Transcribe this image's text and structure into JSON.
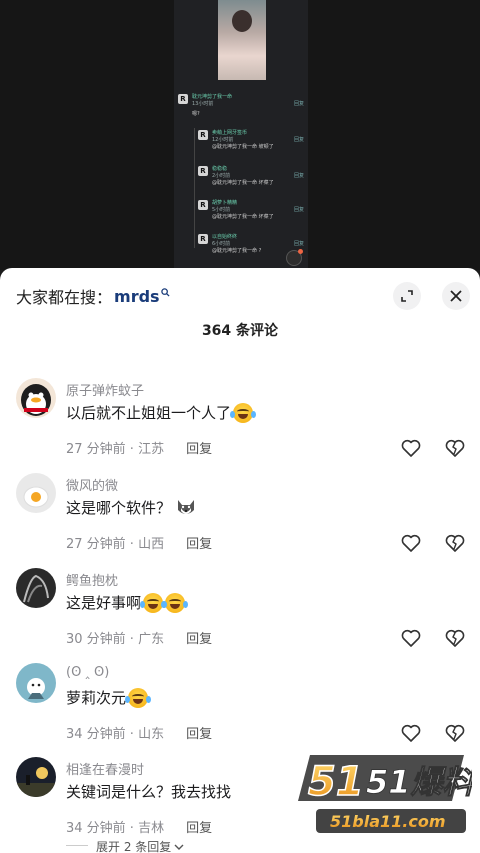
{
  "embedded_thread": {
    "top_comment_user": "耽元坤剪了我一命",
    "top_comment_time": "13小时前",
    "top_comment_text": "嗯?",
    "replies": [
      {
        "user": "卖萌上网牙签币",
        "time": "12小时前",
        "text": "@耽元坤剪了我一命 坡顿了"
      },
      {
        "user": "稳稳稳",
        "time": "2小时前",
        "text": "@耽元坤剪了我一命 坏菜了"
      },
      {
        "user": "胡萝卜精精",
        "time": "5小时前",
        "text": "@耽元坤剪了我一命 坏菜了"
      },
      {
        "user": "以自始终终",
        "time": "6小时前",
        "text": "@耽元坤剪了我一命 ?"
      }
    ],
    "reply_label": "回复"
  },
  "header": {
    "search_prefix": "大家都在搜：",
    "search_keyword": "mrds",
    "comment_count_title": "364 条评论"
  },
  "comments": [
    {
      "user": "原子弹炸蚊子",
      "text": "以后就不止姐姐一个人了",
      "emoji": "laugh-cry-emoji",
      "time": "27 分钟前 · 江苏",
      "reply": "回复"
    },
    {
      "user": "微风的微",
      "text": "这是哪个软件？",
      "emoji": "husky-emoji",
      "time": "27 分钟前 · 山西",
      "reply": "回复"
    },
    {
      "user": "鳄鱼抱枕",
      "text": "这是好事啊",
      "emoji": "laugh-cry-emoji-x2",
      "time": "30 分钟前 · 广东",
      "reply": "回复"
    },
    {
      "user": "(ʘ ‸ ʘ)",
      "text": "萝莉次元",
      "emoji": "laugh-cry-emoji",
      "time": "34 分钟前 · 山东",
      "reply": "回复"
    },
    {
      "user": "相逢在春漫时",
      "text": "关键词是什么？我去找找",
      "emoji": "",
      "time": "34 分钟前 · 吉林",
      "reply": "回复"
    }
  ],
  "expand_replies": "展开 2 条回复",
  "watermark": {
    "brand": "51爆料",
    "url": "51bla11.com"
  },
  "colors": {
    "accent_keyword": "#1a3c7a",
    "meta_gray": "#8a8a8f",
    "watermark_orange": "#f0a52a"
  }
}
